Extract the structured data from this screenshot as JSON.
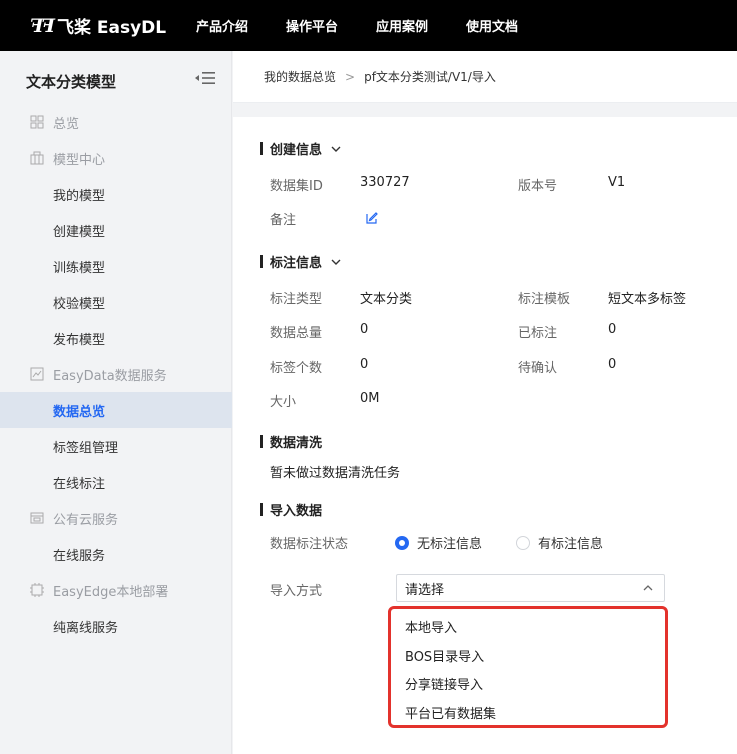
{
  "header": {
    "logo_mark": "飞桨",
    "logo_text": "飞桨 EasyDL",
    "nav": [
      "产品介绍",
      "操作平台",
      "应用案例",
      "使用文档"
    ]
  },
  "sidebar": {
    "title": "文本分类模型",
    "items": [
      {
        "label": "总览",
        "type": "section",
        "icon": "grid-icon"
      },
      {
        "label": "模型中心",
        "type": "section",
        "icon": "model-center-icon"
      },
      {
        "label": "我的模型",
        "type": "child"
      },
      {
        "label": "创建模型",
        "type": "child"
      },
      {
        "label": "训练模型",
        "type": "child"
      },
      {
        "label": "校验模型",
        "type": "child"
      },
      {
        "label": "发布模型",
        "type": "child"
      },
      {
        "label": "EasyData数据服务",
        "type": "section",
        "icon": "chart-icon"
      },
      {
        "label": "数据总览",
        "type": "child",
        "active": true
      },
      {
        "label": "标签组管理",
        "type": "child"
      },
      {
        "label": "在线标注",
        "type": "child"
      },
      {
        "label": "公有云服务",
        "type": "section",
        "icon": "cloud-service-icon"
      },
      {
        "label": "在线服务",
        "type": "child"
      },
      {
        "label": "EasyEdge本地部署",
        "type": "section",
        "icon": "edge-deploy-icon"
      },
      {
        "label": "纯离线服务",
        "type": "child"
      }
    ]
  },
  "breadcrumb": {
    "root": "我的数据总览",
    "separator": ">",
    "current": "pf文本分类测试/V1/导入"
  },
  "create_info": {
    "title": "创建信息",
    "dataset_id_label": "数据集ID",
    "dataset_id": "330727",
    "version_label": "版本号",
    "version": "V1",
    "remark_label": "备注"
  },
  "label_info": {
    "title": "标注信息",
    "type_label": "标注类型",
    "type": "文本分类",
    "template_label": "标注模板",
    "template": "短文本多标签",
    "total_label": "数据总量",
    "total": "0",
    "labeled_label": "已标注",
    "labeled": "0",
    "tag_count_label": "标签个数",
    "tag_count": "0",
    "pending_label": "待确认",
    "pending": "0",
    "size_label": "大小",
    "size": "0M"
  },
  "cleaning": {
    "title": "数据清洗",
    "status": "暂未做过数据清洗任务"
  },
  "import": {
    "title": "导入数据",
    "status_label": "数据标注状态",
    "option_unlabeled": "无标注信息",
    "option_labeled": "有标注信息",
    "method_label": "导入方式",
    "select_placeholder": "请选择",
    "dropdown_options": [
      "本地导入",
      "BOS目录导入",
      "分享链接导入",
      "平台已有数据集"
    ]
  },
  "colors": {
    "accent": "#2468f2",
    "highlight_border": "#e3322c",
    "sidebar_active_bg": "#dde4ee"
  }
}
